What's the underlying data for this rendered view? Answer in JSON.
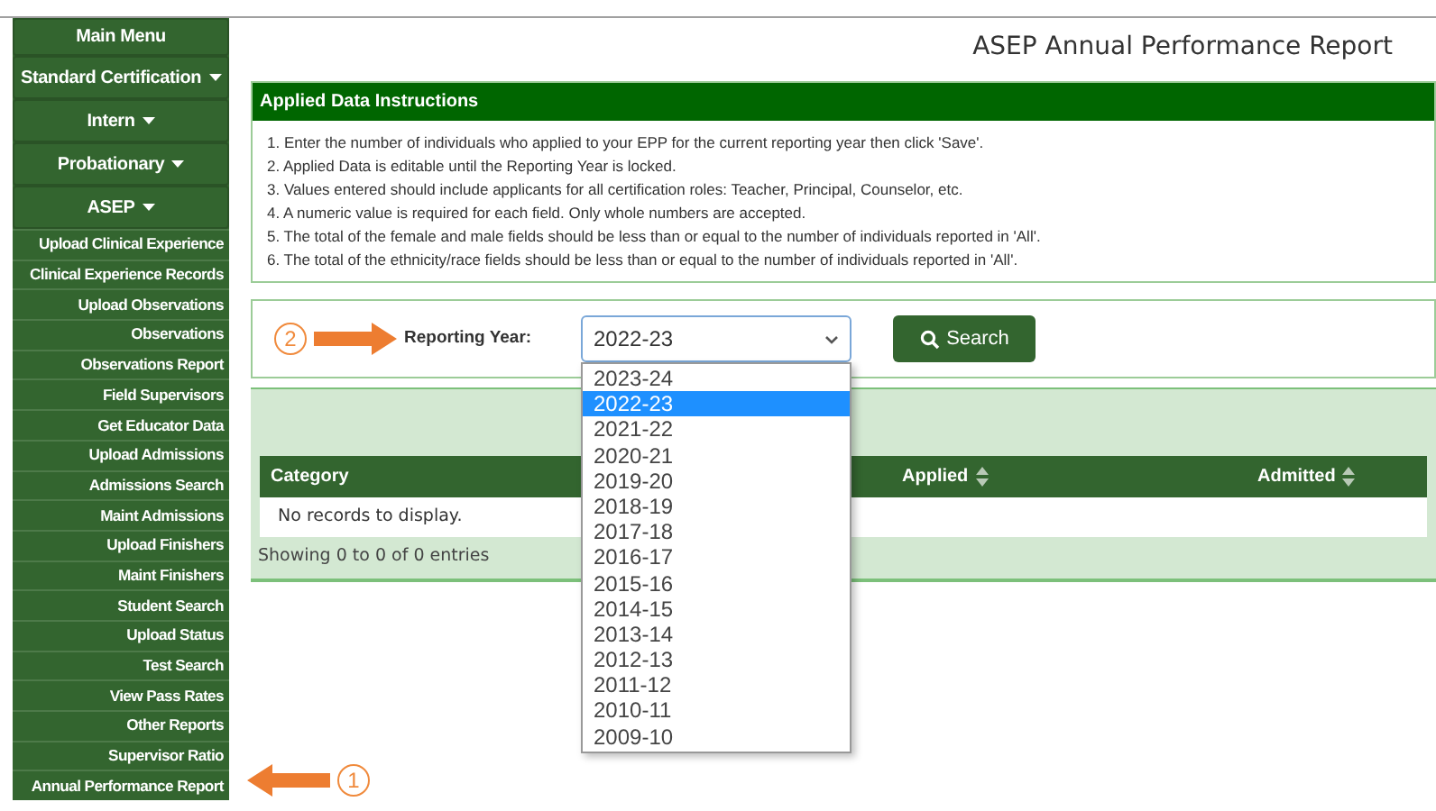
{
  "sidebar": {
    "items": [
      {
        "label": "Main Menu",
        "kind": "header",
        "dropdown": false
      },
      {
        "label": "Standard Certification",
        "kind": "header",
        "dropdown": true
      },
      {
        "label": "Intern",
        "kind": "header",
        "dropdown": true
      },
      {
        "label": "Probationary",
        "kind": "header",
        "dropdown": true
      },
      {
        "label": "ASEP",
        "kind": "header",
        "dropdown": true
      },
      {
        "label": "Upload Clinical Experience",
        "kind": "link",
        "dropdown": false
      },
      {
        "label": "Clinical Experience Records",
        "kind": "link",
        "dropdown": false
      },
      {
        "label": "Upload Observations",
        "kind": "link",
        "dropdown": false
      },
      {
        "label": "Observations",
        "kind": "link",
        "dropdown": false
      },
      {
        "label": "Observations Report",
        "kind": "link",
        "dropdown": false
      },
      {
        "label": "Field Supervisors",
        "kind": "link",
        "dropdown": false
      },
      {
        "label": "Get Educator Data",
        "kind": "link",
        "dropdown": false
      },
      {
        "label": "Upload Admissions",
        "kind": "link",
        "dropdown": false
      },
      {
        "label": "Admissions Search",
        "kind": "link",
        "dropdown": false
      },
      {
        "label": "Maint Admissions",
        "kind": "link",
        "dropdown": false
      },
      {
        "label": "Upload Finishers",
        "kind": "link",
        "dropdown": false
      },
      {
        "label": "Maint Finishers",
        "kind": "link",
        "dropdown": false
      },
      {
        "label": "Student Search",
        "kind": "link",
        "dropdown": false
      },
      {
        "label": "Upload Status",
        "kind": "link",
        "dropdown": false
      },
      {
        "label": "Test Search",
        "kind": "link",
        "dropdown": false
      },
      {
        "label": "View Pass Rates",
        "kind": "link",
        "dropdown": false
      },
      {
        "label": "Other Reports",
        "kind": "link",
        "dropdown": false
      },
      {
        "label": "Supervisor Ratio",
        "kind": "link",
        "dropdown": false
      },
      {
        "label": "Annual Performance Report",
        "kind": "link",
        "dropdown": false
      }
    ]
  },
  "page_title": "ASEP Annual Performance Report",
  "instructions": {
    "title": "Applied Data Instructions",
    "lines": [
      "1. Enter the number of individuals who applied to your EPP for the current reporting year then click 'Save'.",
      "2. Applied Data is editable until the Reporting Year is locked.",
      "3. Values entered should include applicants for all certification roles: Teacher, Principal, Counselor, etc.",
      "4. A numeric value is required for each field. Only whole numbers are accepted.",
      "5. The total of the female and male fields should be less than or equal to the number of individuals reported in 'All'.",
      "6. The total of the ethnicity/race fields should be less than or equal to the number of individuals reported in 'All'."
    ]
  },
  "filter": {
    "label": "Reporting Year:",
    "select": {
      "value": "2022-23",
      "expanded": true,
      "options": [
        {
          "label": "2023-24",
          "selected": false
        },
        {
          "label": "2022-23",
          "selected": true
        },
        {
          "label": "2021-22",
          "selected": false
        },
        {
          "label": "2020-21",
          "selected": false
        },
        {
          "label": "2019-20",
          "selected": false
        },
        {
          "label": "2018-19",
          "selected": false
        },
        {
          "label": "2017-18",
          "selected": false
        },
        {
          "label": "2016-17",
          "selected": false
        },
        {
          "label": "2015-16",
          "selected": false
        },
        {
          "label": "2014-15",
          "selected": false
        },
        {
          "label": "2013-14",
          "selected": false
        },
        {
          "label": "2012-13",
          "selected": false
        },
        {
          "label": "2011-12",
          "selected": false
        },
        {
          "label": "2010-11",
          "selected": false
        },
        {
          "label": "2009-10",
          "selected": false
        }
      ]
    },
    "search_button": "Search"
  },
  "table": {
    "columns": [
      {
        "label": "Category",
        "sortable": false
      },
      {
        "label": "Applied",
        "sortable": true
      },
      {
        "label": "Admitted",
        "sortable": true
      }
    ],
    "empty_message": "No records to display.",
    "footer": "Showing 0 to 0 of 0 entries"
  },
  "annotations": [
    {
      "number": "1"
    },
    {
      "number": "2"
    }
  ]
}
